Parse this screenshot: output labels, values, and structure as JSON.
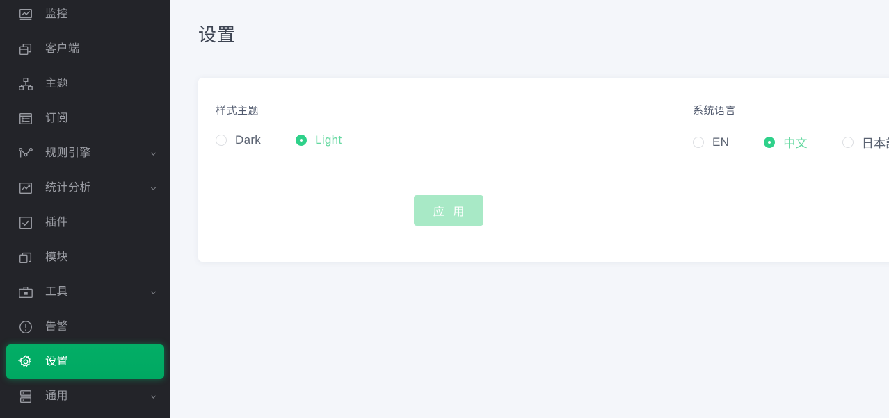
{
  "sidebar": {
    "items": [
      {
        "label": "监控",
        "icon": "monitor-icon",
        "has_arrow": false,
        "active": false
      },
      {
        "label": "客户端",
        "icon": "clients-icon",
        "has_arrow": false,
        "active": false
      },
      {
        "label": "主题",
        "icon": "topics-icon",
        "has_arrow": false,
        "active": false
      },
      {
        "label": "订阅",
        "icon": "subscription-icon",
        "has_arrow": false,
        "active": false
      },
      {
        "label": "规则引擎",
        "icon": "rule-engine-icon",
        "has_arrow": true,
        "active": false
      },
      {
        "label": "统计分析",
        "icon": "analytics-icon",
        "has_arrow": true,
        "active": false
      },
      {
        "label": "插件",
        "icon": "plugins-icon",
        "has_arrow": false,
        "active": false
      },
      {
        "label": "模块",
        "icon": "modules-icon",
        "has_arrow": false,
        "active": false
      },
      {
        "label": "工具",
        "icon": "tools-icon",
        "has_arrow": true,
        "active": false
      },
      {
        "label": "告警",
        "icon": "alert-icon",
        "has_arrow": false,
        "active": false
      },
      {
        "label": "设置",
        "icon": "gear-icon",
        "has_arrow": false,
        "active": true
      },
      {
        "label": "通用",
        "icon": "general-icon",
        "has_arrow": true,
        "active": false
      }
    ]
  },
  "page": {
    "title": "设置"
  },
  "settings": {
    "theme": {
      "label": "样式主题",
      "options": [
        {
          "value": "dark",
          "label": "Dark",
          "selected": false
        },
        {
          "value": "light",
          "label": "Light",
          "selected": true
        }
      ]
    },
    "language": {
      "label": "系统语言",
      "options": [
        {
          "value": "en",
          "label": "EN",
          "selected": false
        },
        {
          "value": "zh",
          "label": "中文",
          "selected": true
        },
        {
          "value": "ja",
          "label": "日本語",
          "selected": false
        }
      ]
    },
    "apply_button": "应 用"
  },
  "colors": {
    "sidebar_bg": "#232429",
    "active_green": "#00a862",
    "accent_green": "#2fd18a",
    "apply_btn_bg": "#a8e9c6",
    "page_bg": "#f4f6fa"
  }
}
